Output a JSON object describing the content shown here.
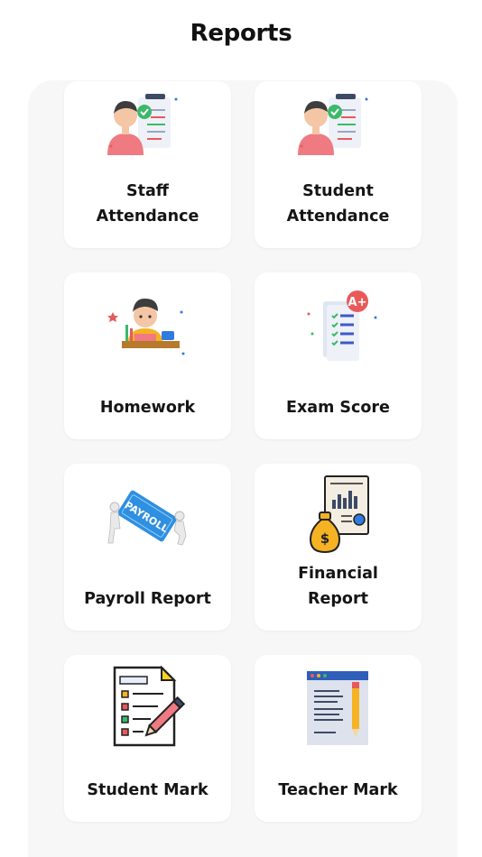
{
  "page": {
    "title": "Reports"
  },
  "cards": [
    {
      "lines": [
        "Staff",
        "Attendance"
      ],
      "icon": "staff-attendance-icon"
    },
    {
      "lines": [
        "Student",
        "Attendance"
      ],
      "icon": "student-attendance-icon"
    },
    {
      "lines": [
        "Homework"
      ],
      "icon": "homework-icon"
    },
    {
      "lines": [
        "Exam Score"
      ],
      "icon": "exam-score-icon"
    },
    {
      "lines": [
        "Payroll Report"
      ],
      "icon": "payroll-report-icon"
    },
    {
      "lines": [
        "Financial",
        "Report"
      ],
      "icon": "financial-report-icon"
    },
    {
      "lines": [
        "Student Mark"
      ],
      "icon": "student-mark-icon"
    },
    {
      "lines": [
        "Teacher Mark"
      ],
      "icon": "teacher-mark-icon"
    }
  ],
  "icon_text": {
    "payroll": "PAYROLL",
    "dollar": "$",
    "grade": "A+"
  },
  "colors": {
    "accent_blue": "#2f7be0",
    "accent_red": "#e85a5a",
    "accent_green": "#3cb96a",
    "accent_yellow": "#f5b324"
  }
}
